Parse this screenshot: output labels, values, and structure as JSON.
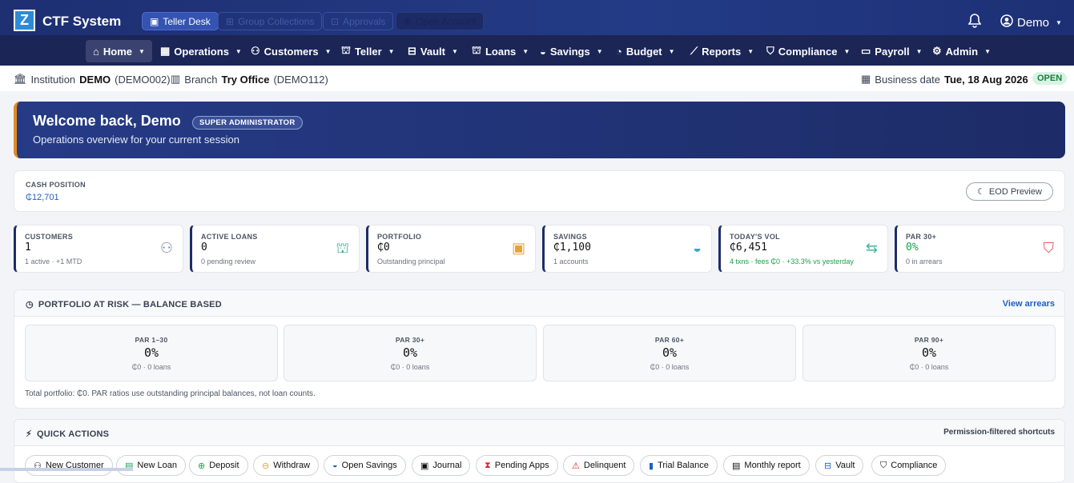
{
  "app": {
    "title": "CTF System",
    "logo_letter": "Z"
  },
  "topbar": {
    "pills": [
      {
        "label": "Teller Desk",
        "icon": "teller-icon",
        "state": "active"
      },
      {
        "label": "Group Collections",
        "icon": "group-icon",
        "state": "dim"
      },
      {
        "label": "Approvals",
        "icon": "approvals-icon",
        "state": "dim"
      },
      {
        "label": "Open Account",
        "icon": "user-plus-icon",
        "state": "dark"
      }
    ],
    "user_name": "Demo"
  },
  "nav": {
    "items": [
      {
        "label": "Home",
        "icon": "home-icon"
      },
      {
        "label": "Operations",
        "icon": "calendar-icon"
      },
      {
        "label": "Customers",
        "icon": "users-icon"
      },
      {
        "label": "Teller",
        "icon": "bank-icon"
      },
      {
        "label": "Vault",
        "icon": "vault-icon"
      },
      {
        "label": "Loans",
        "icon": "bank-icon"
      },
      {
        "label": "Savings",
        "icon": "piggy-icon"
      },
      {
        "label": "Budget",
        "icon": "pie-icon"
      },
      {
        "label": "Reports",
        "icon": "chart-icon"
      },
      {
        "label": "Compliance",
        "icon": "shield-icon"
      },
      {
        "label": "Payroll",
        "icon": "wallet-icon"
      },
      {
        "label": "Admin",
        "icon": "gear-icon"
      }
    ]
  },
  "info": {
    "institution_label": "Institution",
    "institution_name": "DEMO",
    "institution_code": "(DEMO002)",
    "branch_label": "Branch",
    "branch_name": "Try Office",
    "branch_code": "(DEMO112)",
    "business_date_label": "Business date",
    "business_date": "Tue, 18 Aug 2026",
    "status": "OPEN"
  },
  "welcome": {
    "title": "Welcome back, Demo",
    "role_badge": "SUPER ADMINISTRATOR",
    "subtitle": "Operations overview for your current session"
  },
  "cash": {
    "label": "CASH POSITION",
    "value": "₵12,701",
    "eod_label": "EOD Preview"
  },
  "stats": [
    {
      "label": "CUSTOMERS",
      "value": "1",
      "sub": "1 active · +1 MTD",
      "icon": "users-icon",
      "color": "#7d8ba6"
    },
    {
      "label": "ACTIVE LOANS",
      "value": "0",
      "sub": "0 pending review",
      "icon": "bank-icon",
      "color": "#34a98a"
    },
    {
      "label": "PORTFOLIO",
      "value": "₵0",
      "sub": "Outstanding principal",
      "icon": "cash-icon",
      "color": "#e6a23c"
    },
    {
      "label": "SAVINGS",
      "value": "₵1,100",
      "sub": "1 accounts",
      "icon": "piggy-icon",
      "color": "#3aa7c9"
    },
    {
      "label": "TODAY'S VOL",
      "value": "₵6,451",
      "sub": "4 txns · fees ₵0 · +33.3% vs yesterday",
      "icon": "swap-icon",
      "color": "#3fb6a0"
    },
    {
      "label": "PAR 30+",
      "value": "0%",
      "sub": "0 in arrears",
      "icon": "alert-shield-icon",
      "color": "#e25b5b"
    }
  ],
  "par": {
    "title": "PORTFOLIO AT RISK — BALANCE BASED",
    "link": "View arrears",
    "buckets": [
      {
        "label": "PAR 1–30",
        "value": "0%",
        "sub": "₵0 · 0 loans"
      },
      {
        "label": "PAR 30+",
        "value": "0%",
        "sub": "₵0 · 0 loans"
      },
      {
        "label": "PAR 60+",
        "value": "0%",
        "sub": "₵0 · 0 loans"
      },
      {
        "label": "PAR 90+",
        "value": "0%",
        "sub": "₵0 · 0 loans"
      }
    ],
    "note": "Total portfolio: ₵0. PAR ratios use outstanding principal balances, not loan counts."
  },
  "quick": {
    "title": "QUICK ACTIONS",
    "right": "Permission-filtered shortcuts",
    "actions": [
      {
        "label": "New Customer",
        "icon": "user-plus-icon"
      },
      {
        "label": "New Loan",
        "icon": "doc-plus-icon"
      },
      {
        "label": "Deposit",
        "icon": "plus-circle-icon"
      },
      {
        "label": "Withdraw",
        "icon": "minus-circle-icon"
      },
      {
        "label": "Open Savings",
        "icon": "piggy-icon"
      },
      {
        "label": "Journal",
        "icon": "journal-icon"
      },
      {
        "label": "Pending Apps",
        "icon": "hourglass-icon"
      },
      {
        "label": "Delinquent",
        "icon": "warning-icon"
      },
      {
        "label": "Trial Balance",
        "icon": "bar-chart-icon"
      },
      {
        "label": "Monthly report",
        "icon": "report-icon"
      },
      {
        "label": "Vault",
        "icon": "vault-icon"
      },
      {
        "label": "Compliance",
        "icon": "shield-icon"
      }
    ]
  }
}
